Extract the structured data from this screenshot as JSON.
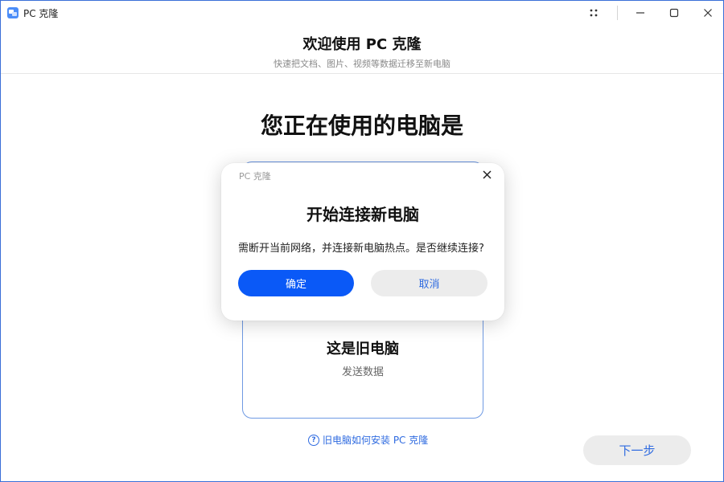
{
  "window": {
    "title": "PC 克隆",
    "controls": {
      "more": "dots-grid-icon",
      "minimize": "minimize-icon",
      "maximize": "maximize-icon",
      "close": "close-icon"
    }
  },
  "header": {
    "title": "欢迎使用 PC 克隆",
    "subtitle": "快速把文档、图片、视频等数据迁移至新电脑"
  },
  "main": {
    "heading": "您正在使用的电脑是",
    "option_card": {
      "title": "这是旧电脑",
      "subtitle": "发送数据"
    },
    "help_link": "旧电脑如何安装 PC 克隆",
    "help_icon_glyph": "?",
    "next_button": "下一步"
  },
  "dialog": {
    "app_name": "PC 克隆",
    "title": "开始连接新电脑",
    "message": "需断开当前网络，并连接新电脑热点。是否继续连接?",
    "confirm_label": "确定",
    "cancel_label": "取消"
  },
  "colors": {
    "accent": "#0a59f7",
    "link": "#2f6be0",
    "card_border": "#6f9ae3",
    "secondary_button_bg": "#ececec"
  }
}
